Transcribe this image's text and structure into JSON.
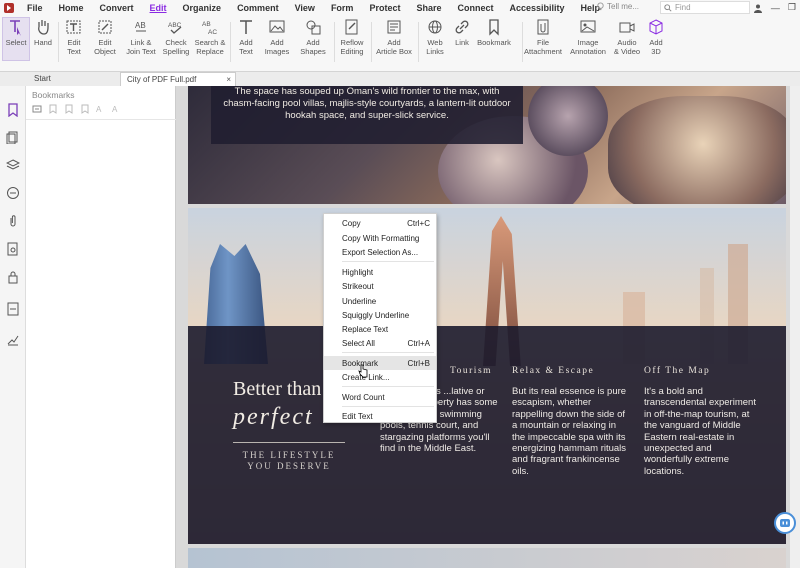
{
  "menubar": {
    "items": [
      "File",
      "Home",
      "Convert",
      "Edit",
      "Organize",
      "Comment",
      "View",
      "Form",
      "Protect",
      "Share",
      "Connect",
      "Accessibility",
      "Help"
    ],
    "active": "Edit",
    "tell_me": "Tell me...",
    "find_placeholder": "Find"
  },
  "ribbon": {
    "select": "Select",
    "hand": "Hand",
    "edit_text": [
      "Edit",
      "Text"
    ],
    "edit_object": [
      "Edit",
      "Object"
    ],
    "link_join": [
      "Link &",
      "Join Text"
    ],
    "check_spelling": [
      "Check",
      "Spelling"
    ],
    "search_replace": [
      "Search &",
      "Replace"
    ],
    "add_text": [
      "Add",
      "Text"
    ],
    "add_images": [
      "Add",
      "Images"
    ],
    "add_shapes": [
      "Add",
      "Shapes"
    ],
    "reflow_editing": [
      "Reflow",
      "Editing"
    ],
    "add_article_box": [
      "Add",
      "Article Box"
    ],
    "web_links": [
      "Web",
      "Links"
    ],
    "link": "Link",
    "bookmark": "Bookmark",
    "file_attachment": [
      "File",
      "Attachment"
    ],
    "image_annotation": [
      "Image",
      "Annotation"
    ],
    "audio_video": [
      "Audio",
      "& Video"
    ],
    "add_3d": [
      "Add",
      "3D"
    ]
  },
  "tabs": {
    "start": "Start",
    "document": "City of PDF Full.pdf"
  },
  "bookmarks_panel": {
    "title": "Bookmarks"
  },
  "page1": {
    "text": "The space has souped up Oman's wild frontier to the max, with chasm-facing pool villas, majlis-style courtyards, a lantern-lit outdoor hookah space, and super-slick service."
  },
  "page2": {
    "headline_1": "Better than",
    "headline_2": "perfect",
    "subtitle": "THE LIFESTYLE YOU DESERVE",
    "columns": [
      {
        "heading": "Tourism",
        "body": "splashy ... has ...lative or two: The property has some of the highest swimming pools, tennis court, and stargazing platforms you'll find in the Middle East."
      },
      {
        "heading": "Relax & Escape",
        "body": "But its real essence is pure escapism, whether rappelling down the side of a mountain or relaxing in the impeccable spa with its energizing hammam rituals and fragrant frankincense oils."
      },
      {
        "heading": "Off The Map",
        "body": "It's a bold and transcendental experiment in off-the-map tourism, at the vanguard of Middle Eastern real-estate in unexpected and wonderfully extreme locations."
      }
    ]
  },
  "context_menu": {
    "items": [
      {
        "label": "Copy",
        "shortcut": "Ctrl+C"
      },
      {
        "label": "Copy With Formatting",
        "shortcut": ""
      },
      {
        "label": "Export Selection As...",
        "shortcut": ""
      },
      {
        "label": "Highlight",
        "shortcut": ""
      },
      {
        "label": "Strikeout",
        "shortcut": ""
      },
      {
        "label": "Underline",
        "shortcut": ""
      },
      {
        "label": "Squiggly Underline",
        "shortcut": ""
      },
      {
        "label": "Replace Text",
        "shortcut": ""
      },
      {
        "label": "Select All",
        "shortcut": "Ctrl+A"
      },
      {
        "label": "Bookmark",
        "shortcut": "Ctrl+B"
      },
      {
        "label": "Create Link...",
        "shortcut": ""
      },
      {
        "label": "Word Count",
        "shortcut": ""
      },
      {
        "label": "Edit Text",
        "shortcut": ""
      }
    ],
    "highlighted": "Bookmark"
  },
  "colors": {
    "accent": "#8a2be2",
    "overlay": "#1c1b2d",
    "page_text": "#f1ece4"
  }
}
